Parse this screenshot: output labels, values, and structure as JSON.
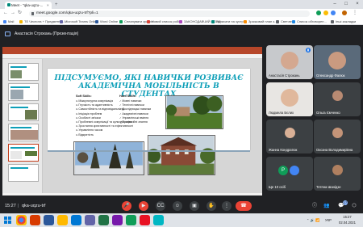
{
  "browser": {
    "tab_title": "Meet - \"qka-uqzu-...",
    "url": "meet.google.com/qka-uqzu-trf?pli=1",
    "bookmarks": [
      {
        "label": "Mail",
        "color": "#4285f4"
      },
      {
        "label": "TE Чеснота + Предметни...",
        "color": "#f4b400"
      },
      {
        "label": "Microsoft Teams Online",
        "color": "#6264a7"
      },
      {
        "label": "Word Online",
        "color": "#2b579a"
      },
      {
        "label": "Спланувати зустріч",
        "color": "#0f9d58"
      },
      {
        "label": "Новий список робіт",
        "color": "#db4437"
      },
      {
        "label": "ЗАКОНОДАВЧИЙ ФОНД",
        "color": "#ab47bc"
      },
      {
        "label": "Записати на зустріч",
        "color": "#00897b"
      },
      {
        "label": "Зразковий план з...",
        "color": "#fb8c00"
      },
      {
        "label": "Свет.вес/",
        "color": "#5f6368"
      },
      {
        "label": "Список обговорен...",
        "color": "#1e88e5"
      },
      {
        "label": "Інші закладки",
        "color": "#5f6368"
      }
    ]
  },
  "meet": {
    "presenter": "Анастасія Строкань (Презентація)",
    "time": "15:27",
    "code": "qka-uqzu-trf",
    "people_count": "17"
  },
  "slide": {
    "title_line1": "ПІДСУМУЄМО, ЯКІ НАВИЧКИ РОЗВИВАЄ",
    "title_line2": "АКАДЕМІЧНА МОБІЛЬНІСТЬ В СТУДЕНТАХ",
    "soft_heading": "Soft Skills:",
    "soft_skills": [
      "Міжкультурна комунікація",
      "Гнучкість та адаптивність",
      "Самостійність та відповідальність",
      "Ініціація проблем",
      "Особисті зв'язки",
      "Проблемні комунікації та культура мови",
      "Зростання креативності та ефективності",
      "Управління часом",
      "Відкритість"
    ],
    "hard_heading": "Hard Skills:",
    "hard_skills": [
      "Мовні навички",
      "Технічні навички",
      "Дослідницькі навички",
      "Академічні навички",
      "Управлінські вміння",
      "Професійні знання"
    ]
  },
  "participants": [
    {
      "name": "Анастасія Строкань",
      "initial": "",
      "color": "#5f6368"
    },
    {
      "name": "Олександр Фалюк",
      "initial": "",
      "color": "#3c4043"
    },
    {
      "name": "Людмила Бєлих",
      "initial": "",
      "color": "#3c4043"
    },
    {
      "name": "Ольга Ємченко",
      "initial": "",
      "color": "#3c4043"
    },
    {
      "name": "Жанна Кондратюк",
      "initial": "",
      "color": "#3c4043"
    },
    {
      "name": "Оксана Володимирівна",
      "initial": "",
      "color": "#3c4043"
    },
    {
      "name": "Ще 10 осіб",
      "initial": "P",
      "color": "#3c4043"
    },
    {
      "name": "Тетяна Шанідзе",
      "initial": "",
      "color": "#3c4043"
    }
  ],
  "taskbar": {
    "lang": "УКР",
    "time": "15:27",
    "date": "02.04.2021"
  }
}
